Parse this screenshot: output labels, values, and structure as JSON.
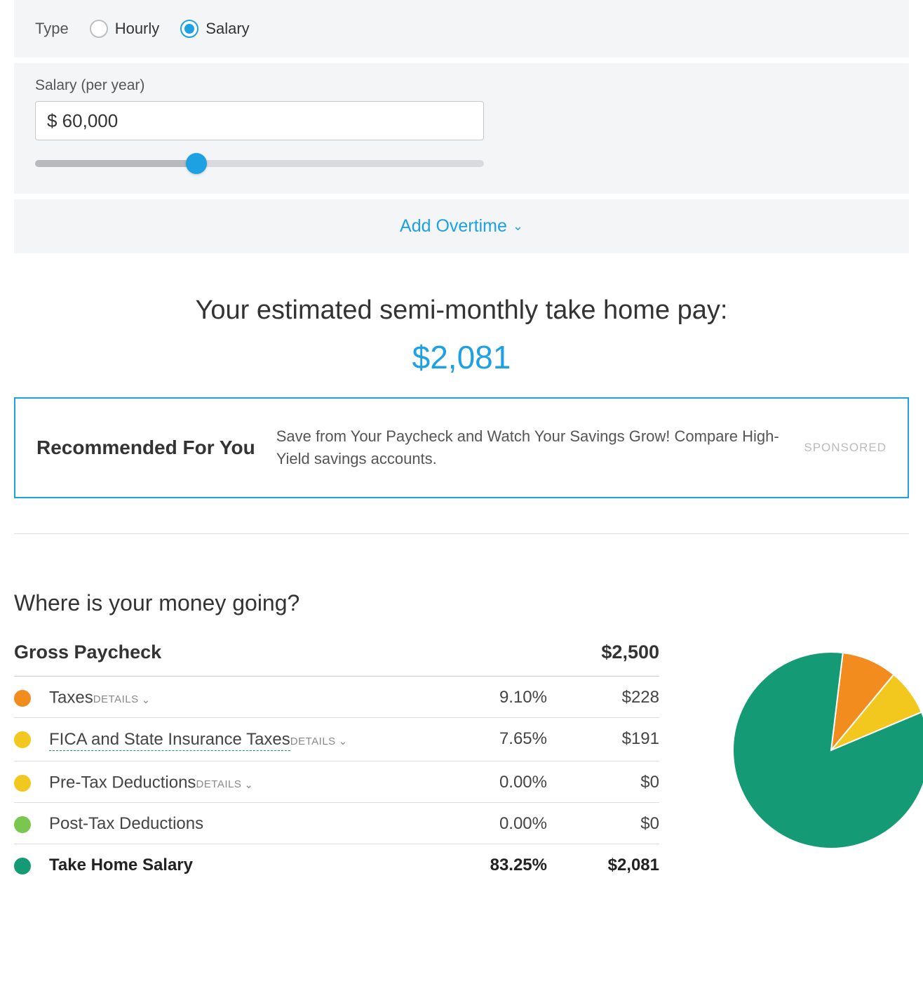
{
  "type_section": {
    "label": "Type",
    "options": {
      "hourly": "Hourly",
      "salary": "Salary"
    },
    "selected": "salary"
  },
  "salary_section": {
    "label": "Salary (per year)",
    "value": "$ 60,000",
    "slider_percent": 36
  },
  "overtime_link": "Add Overtime",
  "result": {
    "title": "Your estimated semi-monthly take home pay:",
    "amount": "$2,081"
  },
  "promo": {
    "title": "Recommended For You",
    "text": "Save from Your Paycheck and Watch Your Savings Grow! Compare High-Yield savings accounts.",
    "sponsored": "SPONSORED"
  },
  "breakdown": {
    "title": "Where is your money going?",
    "gross_label": "Gross Paycheck",
    "gross_amount": "$2,500",
    "details_label": "DETAILS",
    "rows": [
      {
        "name": "Taxes",
        "percent": "9.10%",
        "amount": "$228",
        "color": "#f28c1f",
        "has_details": true,
        "underlined": false,
        "bold": false
      },
      {
        "name": "FICA and State Insurance Taxes",
        "percent": "7.65%",
        "amount": "$191",
        "color": "#f2c81f",
        "has_details": true,
        "underlined": true,
        "bold": false
      },
      {
        "name": "Pre-Tax Deductions",
        "percent": "0.00%",
        "amount": "$0",
        "color": "#f2c81f",
        "has_details": true,
        "underlined": false,
        "bold": false
      },
      {
        "name": "Post-Tax Deductions",
        "percent": "0.00%",
        "amount": "$0",
        "color": "#7ac74f",
        "has_details": false,
        "underlined": false,
        "bold": false
      },
      {
        "name": "Take Home Salary",
        "percent": "83.25%",
        "amount": "$2,081",
        "color": "#159a76",
        "has_details": false,
        "underlined": false,
        "bold": true
      }
    ]
  },
  "chart_data": {
    "type": "pie",
    "title": "Where is your money going?",
    "series": [
      {
        "name": "Taxes",
        "value": 9.1,
        "color": "#f28c1f"
      },
      {
        "name": "FICA and State Insurance Taxes",
        "value": 7.65,
        "color": "#f2c81f"
      },
      {
        "name": "Pre-Tax Deductions",
        "value": 0.0,
        "color": "#f2c81f"
      },
      {
        "name": "Post-Tax Deductions",
        "value": 0.0,
        "color": "#7ac74f"
      },
      {
        "name": "Take Home Salary",
        "value": 83.25,
        "color": "#159a76"
      }
    ]
  }
}
